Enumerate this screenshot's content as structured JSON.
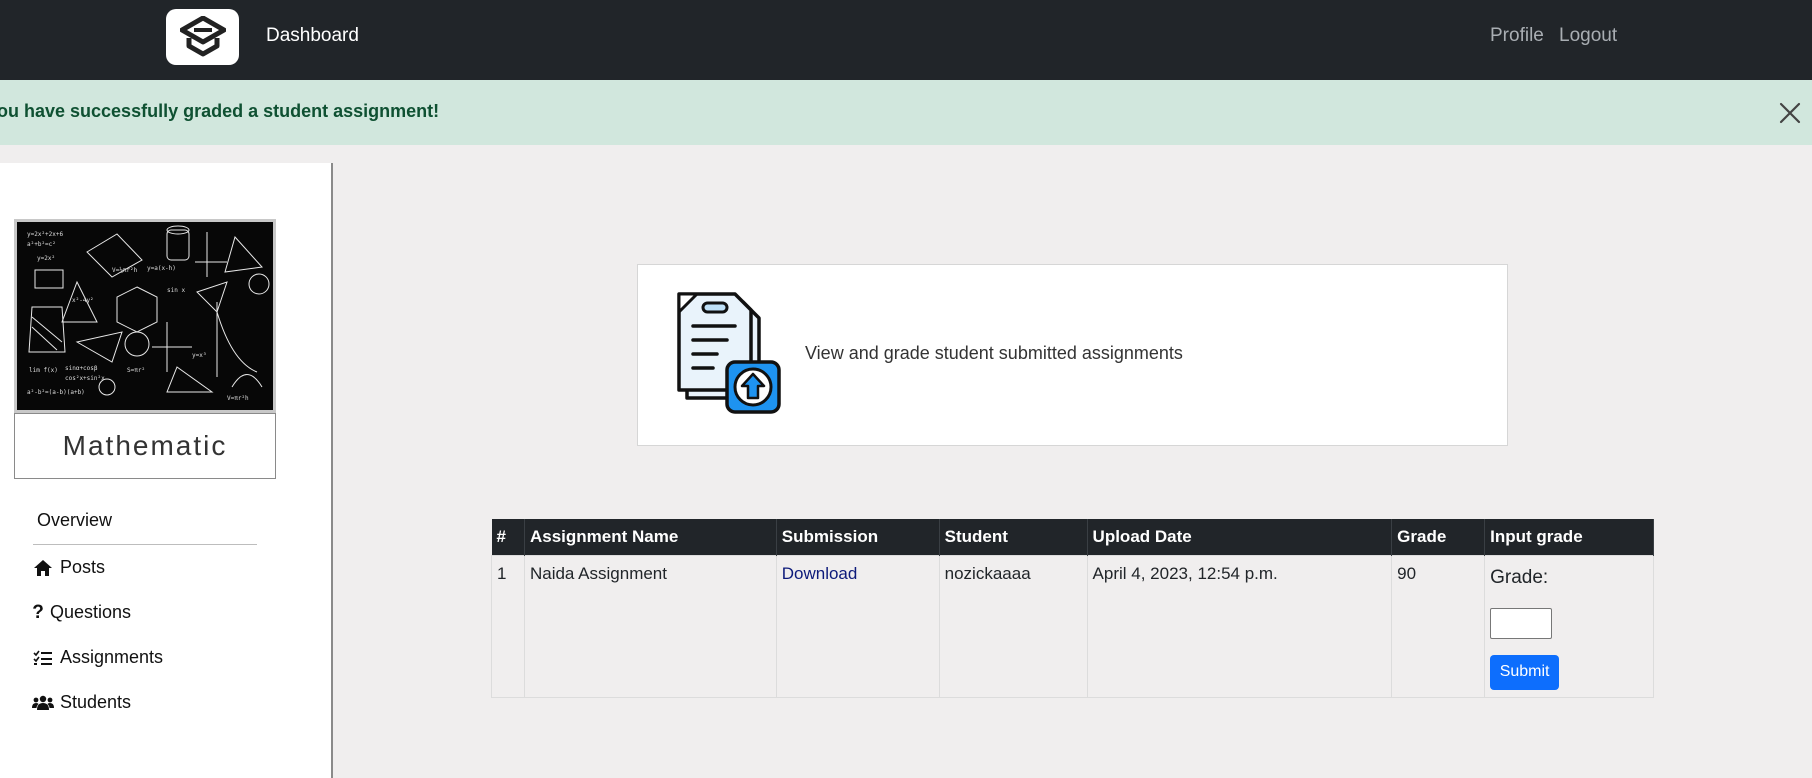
{
  "navbar": {
    "brand": "Dashboard",
    "profile": "Profile",
    "logout": "Logout"
  },
  "alert": {
    "message": "ou have successfully graded a student assignment!"
  },
  "sidebar": {
    "course_name": "Mathematic",
    "items": [
      {
        "label": "Overview",
        "icon": ""
      },
      {
        "label": "Posts",
        "icon": "home-icon"
      },
      {
        "label": "Questions",
        "icon": "question-icon"
      },
      {
        "label": "Assignments",
        "icon": "list-check-icon"
      },
      {
        "label": "Students",
        "icon": "users-icon"
      }
    ]
  },
  "info_card": {
    "text": "View and grade student submitted assignments"
  },
  "table": {
    "headers": [
      "#",
      "Assignment Name",
      "Submission",
      "Student",
      "Upload Date",
      "Grade",
      "Input grade"
    ],
    "rows": [
      {
        "num": "1",
        "name": "Naida Assignment",
        "submission": "Download",
        "student": "nozickaaaa",
        "upload_date": "April 4, 2023, 12:54 p.m.",
        "grade": "90",
        "grade_label": "Grade:",
        "submit_label": "Submit"
      }
    ]
  },
  "colors": {
    "navbar": "#212529",
    "alert_bg": "#d1e7dd",
    "alert_text": "#0f5132",
    "primary": "#0d6efd",
    "page_bg": "#f0eeee"
  }
}
